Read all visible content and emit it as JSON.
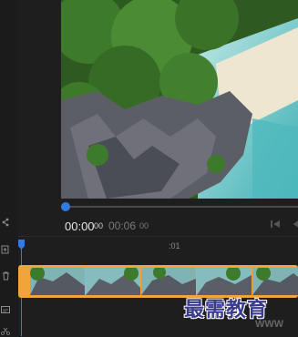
{
  "toolbar": {
    "icons": [
      "share-icon",
      "add-track-icon",
      "trash-icon",
      "caption-icon",
      "scissors-icon"
    ]
  },
  "timecode": {
    "current": "00:00",
    "current_frames": "00",
    "total": "00:06",
    "total_frames": "00"
  },
  "timeline": {
    "ruler_label": ":01"
  },
  "scrubber": {
    "progress": 0.0
  },
  "watermark": {
    "text": "最需教育",
    "sub": "WWW"
  },
  "colors": {
    "accent": "#2f7de1",
    "clip": "#f0a43a",
    "background": "#1e1e1e"
  }
}
